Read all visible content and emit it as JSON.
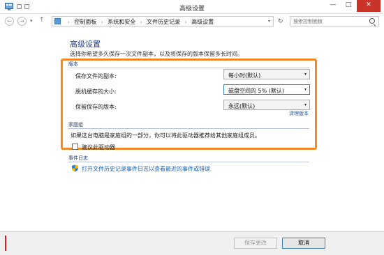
{
  "window": {
    "title": "高级设置",
    "controls": {
      "minimize": "—",
      "maximize": "□",
      "close": "✕"
    }
  },
  "navbar": {
    "back": "←",
    "forward": "→",
    "recent": "▾",
    "up": "↑",
    "breadcrumbs": [
      "控制面板",
      "系统和安全",
      "文件历史记录",
      "高级设置"
    ],
    "crumb_separator": "›",
    "address_dropdown": "▾",
    "refresh": "↻",
    "search_placeholder": "搜索控制面板"
  },
  "page": {
    "title": "高级设置",
    "description": "选择你希望多久保存一次文件副本，以及将保存的版本保留多长时间。"
  },
  "versions": {
    "heading": "版本",
    "rows": [
      {
        "label": "保存文件的副本:",
        "value": "每小时(默认)"
      },
      {
        "label": "脱机缓存的大小:",
        "value": "磁盘空间的 5% (默认)"
      },
      {
        "label": "保留保存的版本:",
        "value": "永远(默认)"
      }
    ],
    "cleanup_link": "清理版本",
    "dropdown_chevron": "▾"
  },
  "homegroup": {
    "heading": "家庭组",
    "description": "如果这台电脑是家庭组的一部分，你可以将此驱动器推荐给其他家庭组成员。",
    "checkbox_label": "建议此驱动器",
    "checkbox_checked": false
  },
  "eventlog": {
    "heading": "事件日志",
    "link": "打开文件历史记录事件日志以查看最近的事件或错误"
  },
  "footer": {
    "save_label": "保存更改",
    "cancel_label": "取消"
  },
  "colors": {
    "accent": "#1f3e8c",
    "link": "#1a5fb4",
    "highlight": "#f08a24",
    "close_button": "#c9342a"
  }
}
